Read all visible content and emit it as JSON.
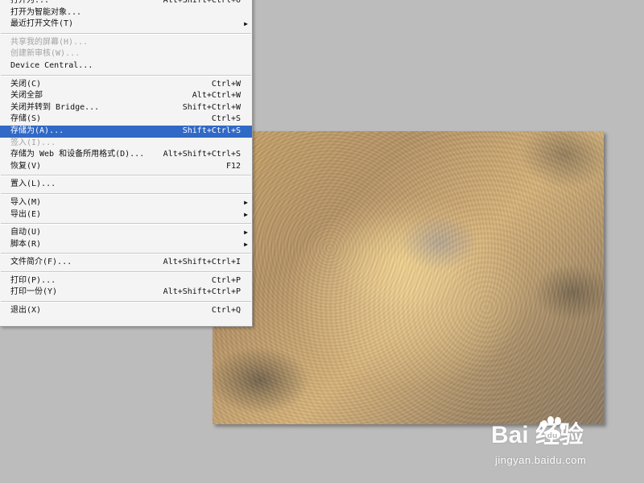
{
  "file_menu": {
    "items": [
      {
        "label": "打开为...",
        "shortcut": "Alt+Shift+Ctrl+O",
        "state": "normal"
      },
      {
        "label": "打开为智能对象...",
        "shortcut": "",
        "state": "normal"
      },
      {
        "label": "最近打开文件(T)",
        "shortcut": "",
        "state": "submenu"
      },
      {
        "sep": true
      },
      {
        "label": "共享我的屏幕(H)...",
        "shortcut": "",
        "state": "disabled"
      },
      {
        "label": "创建新审核(W)...",
        "shortcut": "",
        "state": "disabled"
      },
      {
        "label": "Device Central...",
        "shortcut": "",
        "state": "normal"
      },
      {
        "sep": true
      },
      {
        "label": "关闭(C)",
        "shortcut": "Ctrl+W",
        "state": "normal"
      },
      {
        "label": "关闭全部",
        "shortcut": "Alt+Ctrl+W",
        "state": "normal"
      },
      {
        "label": "关闭并转到 Bridge...",
        "shortcut": "Shift+Ctrl+W",
        "state": "normal"
      },
      {
        "label": "存储(S)",
        "shortcut": "Ctrl+S",
        "state": "normal"
      },
      {
        "label": "存储为(A)...",
        "shortcut": "Shift+Ctrl+S",
        "state": "selected"
      },
      {
        "label": "签入(I)...",
        "shortcut": "",
        "state": "disabled"
      },
      {
        "label": "存储为 Web 和设备所用格式(D)...",
        "shortcut": "Alt+Shift+Ctrl+S",
        "state": "normal"
      },
      {
        "label": "恢复(V)",
        "shortcut": "F12",
        "state": "normal"
      },
      {
        "sep": true
      },
      {
        "label": "置入(L)...",
        "shortcut": "",
        "state": "normal"
      },
      {
        "sep": true
      },
      {
        "label": "导入(M)",
        "shortcut": "",
        "state": "submenu"
      },
      {
        "label": "导出(E)",
        "shortcut": "",
        "state": "submenu"
      },
      {
        "sep": true
      },
      {
        "label": "自动(U)",
        "shortcut": "",
        "state": "submenu"
      },
      {
        "label": "脚本(R)",
        "shortcut": "",
        "state": "submenu"
      },
      {
        "sep": true
      },
      {
        "label": "文件简介(F)...",
        "shortcut": "Alt+Shift+Ctrl+I",
        "state": "normal"
      },
      {
        "sep": true
      },
      {
        "label": "打印(P)...",
        "shortcut": "Ctrl+P",
        "state": "normal"
      },
      {
        "label": "打印一份(Y)",
        "shortcut": "Alt+Shift+Ctrl+P",
        "state": "normal"
      },
      {
        "sep": true
      },
      {
        "label": "退出(X)",
        "shortcut": "Ctrl+Q",
        "state": "normal"
      }
    ]
  },
  "watermark": {
    "brand": "Bai  经验",
    "url": "jingyan.baidu.com"
  },
  "colors": {
    "menu_bg": "#f4f4f4",
    "selection": "#3169c6",
    "workspace": "#bcbcbc"
  }
}
